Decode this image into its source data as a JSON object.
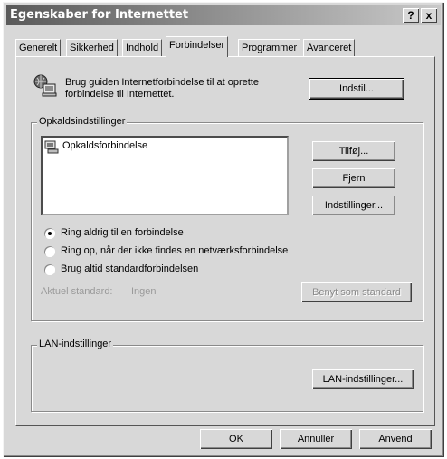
{
  "window": {
    "title": "Egenskaber for Internettet",
    "help_glyph": "?",
    "close_glyph": "x"
  },
  "tabs": [
    {
      "label": "Generelt"
    },
    {
      "label": "Sikkerhed"
    },
    {
      "label": "Indhold"
    },
    {
      "label": "Forbindelser",
      "active": true
    },
    {
      "label": "Programmer"
    },
    {
      "label": "Avanceret"
    }
  ],
  "wizard": {
    "text_line1": "Brug guiden Internetforbindelse til at oprette",
    "text_line2": "forbindelse til Internettet.",
    "setup_button": "Indstil..."
  },
  "dialup": {
    "group_title": "Opkaldsindstillinger",
    "connections": [
      {
        "name": "Opkaldsforbindelse"
      }
    ],
    "add_button": "Tilføj...",
    "remove_button": "Fjern",
    "settings_button": "Indstillinger...",
    "radio_options": [
      {
        "label": "Ring aldrig til en forbindelse",
        "selected": true
      },
      {
        "label": "Ring op, når der ikke findes en netværksforbindelse",
        "selected": false
      },
      {
        "label": "Brug altid standardforbindelsen",
        "selected": false
      }
    ],
    "current_default_label": "Aktuel standard:",
    "current_default_value": "Ingen",
    "set_default_button": "Benyt som standard"
  },
  "lan": {
    "group_title": "LAN-indstillinger",
    "lan_button": "LAN-indstillinger..."
  },
  "footer": {
    "ok": "OK",
    "cancel": "Annuller",
    "apply": "Anvend"
  },
  "colors": {
    "face": "#d8d8d8",
    "title_gradient_start": "#5a5a5a",
    "title_gradient_end": "#c9c9c9"
  }
}
